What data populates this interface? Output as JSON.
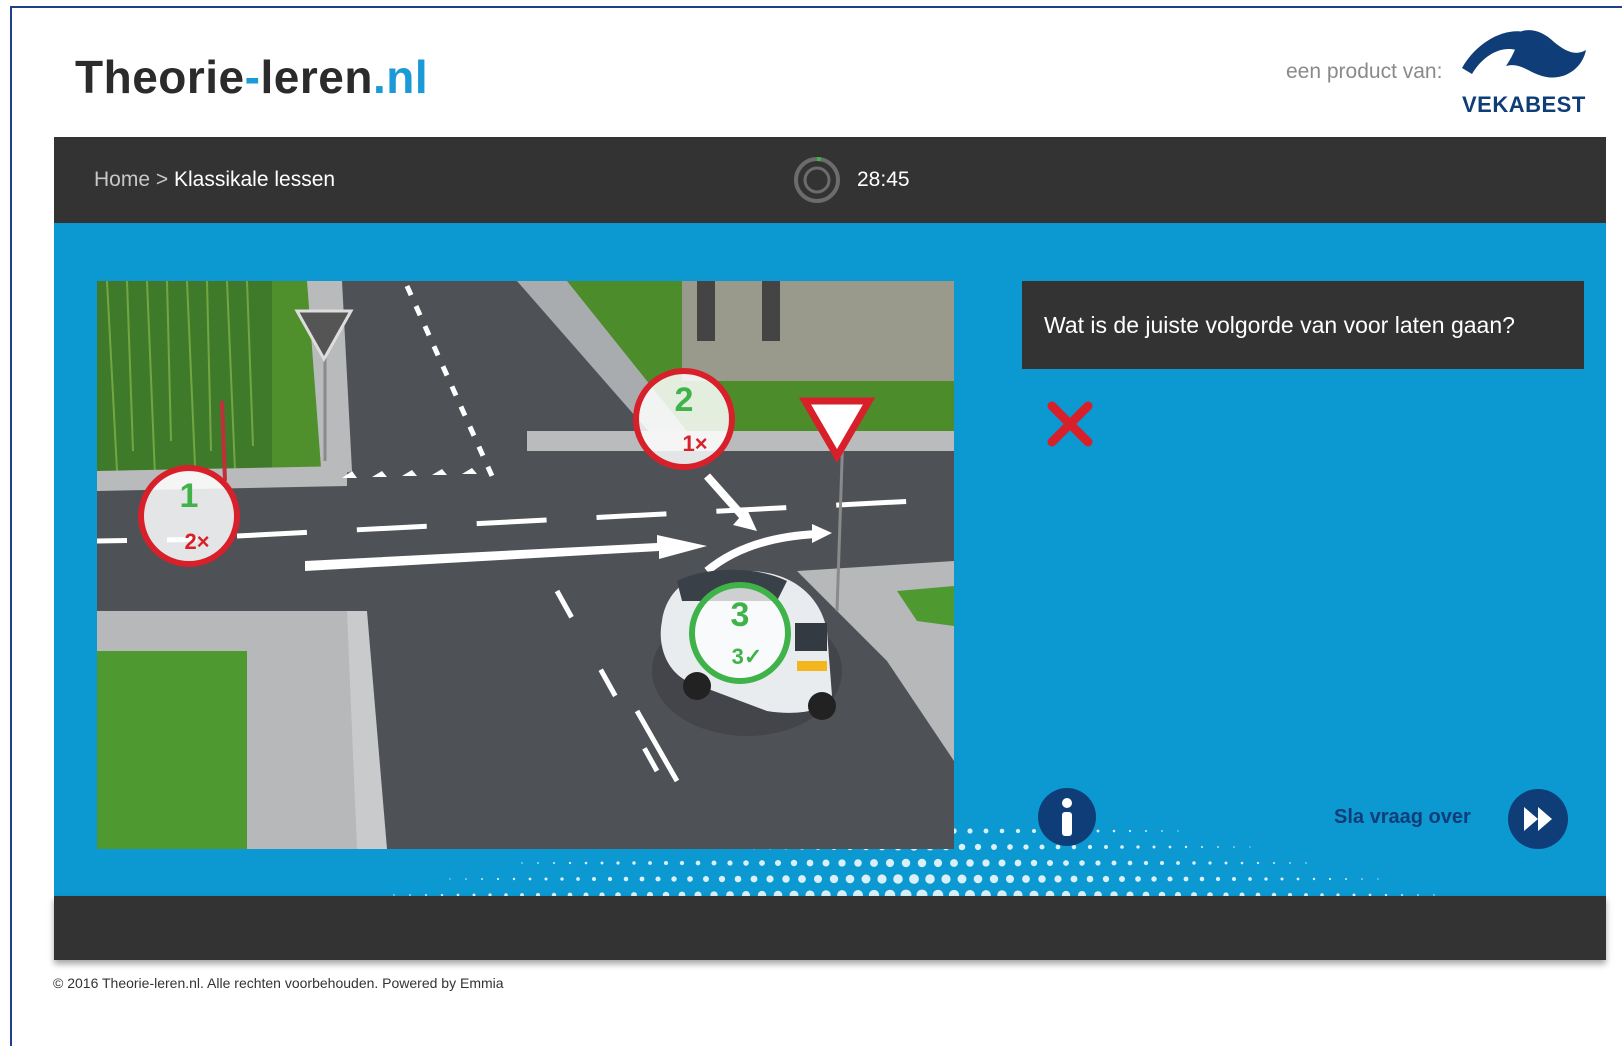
{
  "header": {
    "logo": {
      "name": "Theorie",
      "dash": "-",
      "name2": "leren",
      "tld": ".nl"
    },
    "product_of": "een product van:",
    "partner_logo_text": "VEKABEST"
  },
  "topbar": {
    "breadcrumb": {
      "home": "Home",
      "separator": " > ",
      "current": "Klassikale lessen"
    },
    "timer": "28:45"
  },
  "question": {
    "text": "Wat is de juiste volgorde van voor laten gaan?",
    "result_icon": "wrong-cross-icon"
  },
  "scene": {
    "markers": [
      {
        "number": "1",
        "answer": "2×",
        "status": "wrong"
      },
      {
        "number": "2",
        "answer": "1×",
        "status": "wrong"
      },
      {
        "number": "3",
        "answer": "3✓",
        "status": "correct"
      }
    ]
  },
  "controls": {
    "info_icon": "info-icon",
    "skip_label": "Sla vraag over",
    "skip_icon": "fast-forward-icon"
  },
  "footer": {
    "copyright": "© 2016 Theorie-leren.nl. Alle rechten voorbehouden. Powered by Emmia"
  },
  "colors": {
    "accent_blue": "#0c98d0",
    "dark_navy": "#0f3d78",
    "bar_dark": "#333333",
    "wrong_red": "#d8202a",
    "correct_green": "#3fb34a"
  }
}
